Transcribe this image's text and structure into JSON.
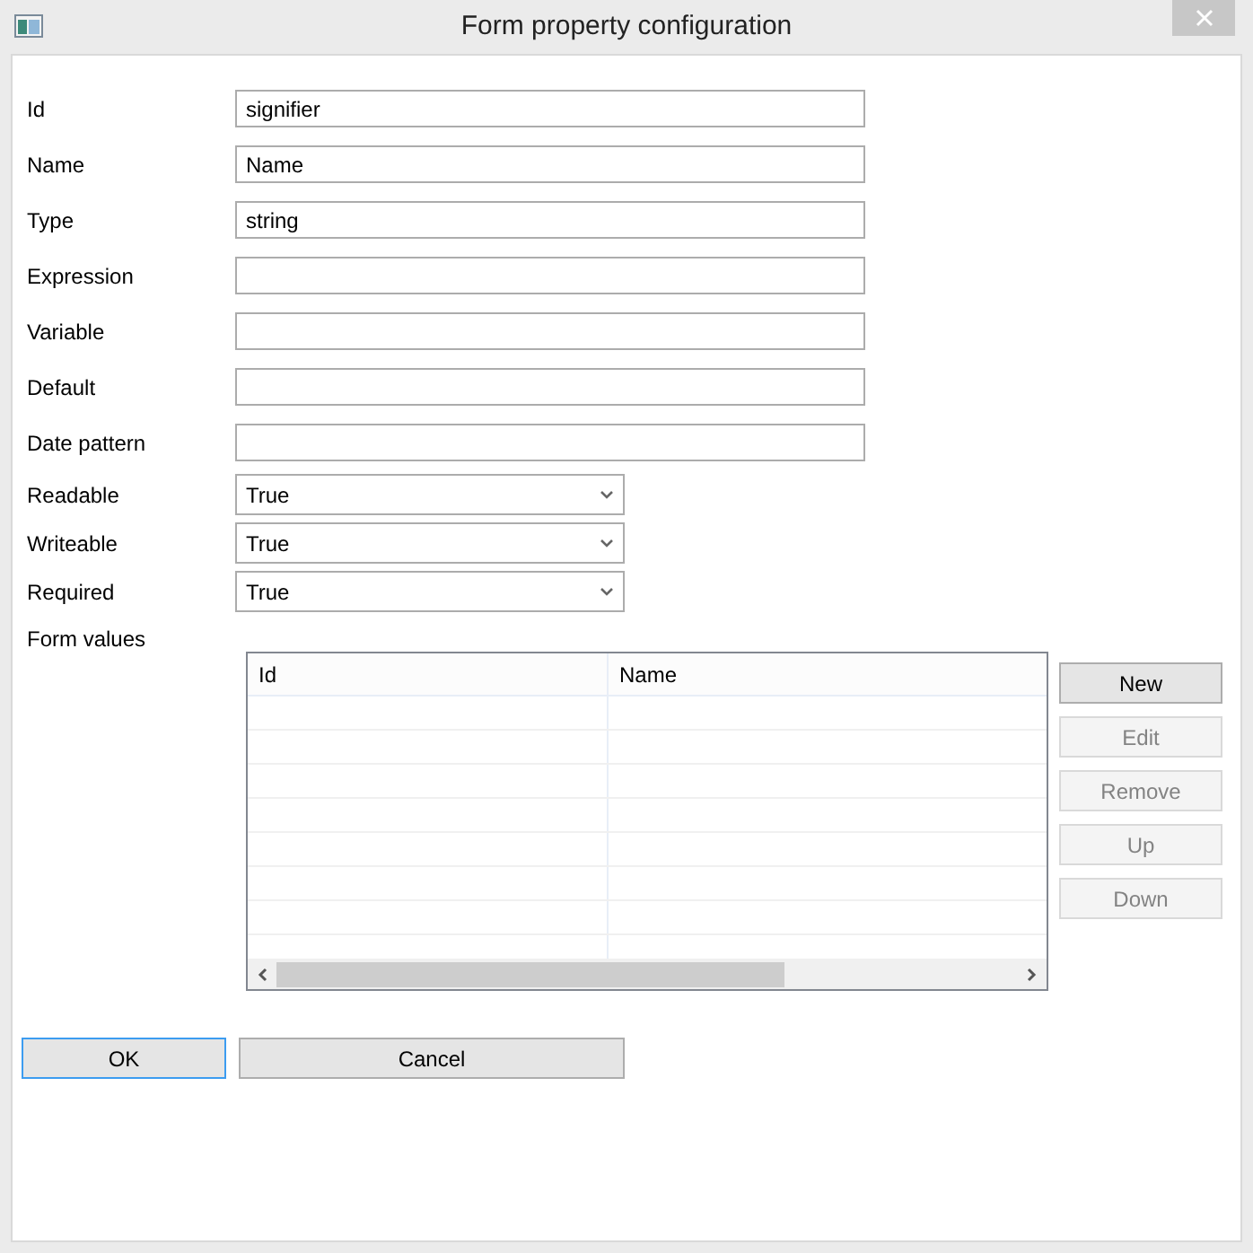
{
  "window": {
    "title": "Form property configuration"
  },
  "fields": [
    {
      "kind": "text",
      "label": "Id",
      "value": "signifier"
    },
    {
      "kind": "text",
      "label": "Name",
      "value": "Name"
    },
    {
      "kind": "text",
      "label": "Type",
      "value": "string"
    },
    {
      "kind": "text",
      "label": "Expression"
    },
    {
      "kind": "text",
      "label": "Variable"
    },
    {
      "kind": "text",
      "label": "Default"
    },
    {
      "kind": "text",
      "label": "Date pattern"
    },
    {
      "kind": "select",
      "label": "Readable",
      "value": "True"
    },
    {
      "kind": "select",
      "label": "Writeable",
      "value": "True"
    },
    {
      "kind": "select",
      "label": "Required",
      "value": "True"
    }
  ],
  "form_values": {
    "label": "Form values",
    "table": {
      "columns": [
        "Id",
        "Name"
      ]
    },
    "buttons": [
      {
        "label": "New",
        "disabled": false
      },
      {
        "label": "Edit",
        "disabled": true
      },
      {
        "label": "Remove",
        "disabled": true
      },
      {
        "label": "Up",
        "disabled": true
      },
      {
        "label": "Down",
        "disabled": true
      }
    ]
  },
  "footer_buttons": [
    {
      "label": "OK",
      "focused": true
    },
    {
      "label": "Cancel",
      "focused": false
    }
  ]
}
